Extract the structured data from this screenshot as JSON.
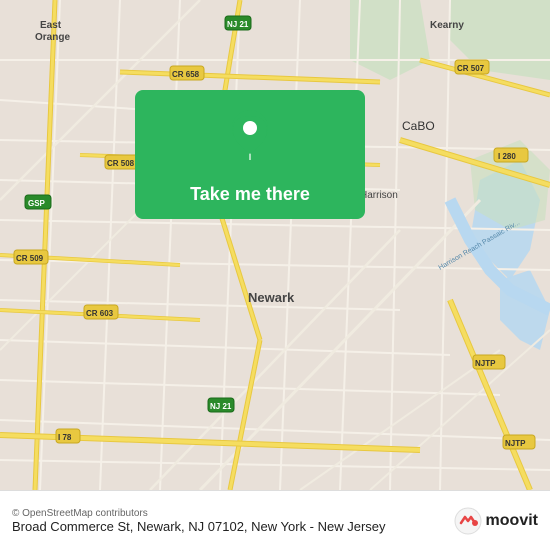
{
  "map": {
    "background_color": "#e8e0d8",
    "button_label": "Take me there",
    "button_bg": "#2db55d"
  },
  "labels": {
    "east_orange": "East\nOrange",
    "kearny": "Kearny",
    "newark": "Newark",
    "harrison": "Harrison",
    "cr658": "CR 658",
    "cr507": "CR 507",
    "cr508": "CR 508",
    "cr509": "CR 509",
    "cr603": "CR 603",
    "gsp": "GSP",
    "nj21": "NJ 21",
    "i280": "I 280",
    "njtp": "NJTP",
    "i78": "I 78",
    "cabo": "CaBO",
    "passaic_river": "Harrison Reach Passaic Riv..."
  },
  "bottom_bar": {
    "copyright": "© OpenStreetMap contributors",
    "address": "Broad Commerce St, Newark, NJ 07102, New York -\nNew Jersey",
    "moovit": "moovit"
  }
}
